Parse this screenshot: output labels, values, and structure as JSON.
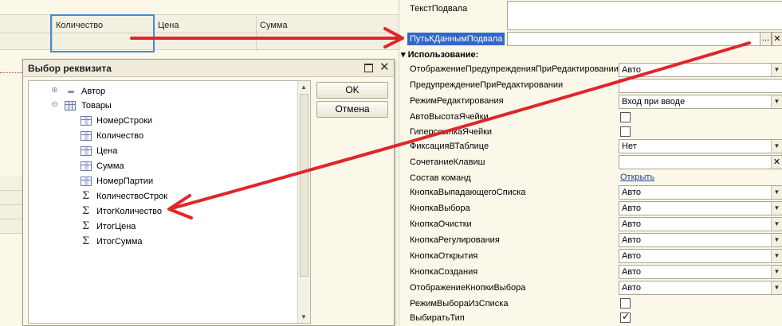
{
  "left_table": {
    "columns": [
      "Количество",
      "Цена",
      "Сумма"
    ]
  },
  "dialog": {
    "title": "Выбор реквизита",
    "ok_label": "OK",
    "cancel_label": "Отмена",
    "tree": {
      "author": "Автор",
      "goods": "Товары",
      "columns": [
        "НомерСтроки",
        "Количество",
        "Цена",
        "Сумма",
        "НомерПартии"
      ],
      "totals": [
        "КоличествоСтрок",
        "ИтогКоличество",
        "ИтогЦена",
        "ИтогСумма"
      ]
    }
  },
  "props": {
    "footer_text_label": "ТекстПодвала",
    "footer_path_label": "ПутьКДаннымПодвала",
    "path_dots": "...",
    "clear_icon": "✕",
    "section_usage": "Использование:",
    "rows": {
      "edit_warning_display": {
        "label": "ОтображениеПредупрежденияПриРедактировании",
        "value": "Авто"
      },
      "edit_warning": {
        "label": "ПредупреждениеПриРедактировании"
      },
      "edit_mode": {
        "label": "РежимРедактирования",
        "value": "Вход при вводе"
      },
      "auto_height": {
        "label": "АвтоВысотаЯчейки"
      },
      "hyperlink": {
        "label": "ГиперссылкаЯчейки"
      },
      "fix_in_table": {
        "label": "ФиксацияВТаблице",
        "value": "Нет"
      },
      "shortcut": {
        "label": "СочетаниеКлавиш"
      },
      "commands": {
        "label": "Состав команд",
        "link": "Открыть"
      },
      "dropdown_button": {
        "label": "КнопкаВыпадающегоСписка",
        "value": "Авто"
      },
      "choice_button": {
        "label": "КнопкаВыбора",
        "value": "Авто"
      },
      "clear_button": {
        "label": "КнопкаОчистки",
        "value": "Авто"
      },
      "adjust_button": {
        "label": "КнопкаРегулирования",
        "value": "Авто"
      },
      "open_button": {
        "label": "КнопкаОткрытия",
        "value": "Авто"
      },
      "create_button": {
        "label": "КнопкаСоздания",
        "value": "Авто"
      },
      "choice_button_display": {
        "label": "ОтображениеКнопкиВыбора",
        "value": "Авто"
      },
      "choice_from_list": {
        "label": "РежимВыбораИзСписка",
        "checked": false
      },
      "choose_type": {
        "label": "ВыбиратьТип",
        "checked": true
      }
    }
  },
  "colors": {
    "arrow": "#e0252b",
    "highlight": "#3c8ed6",
    "selected_label_bg": "#3168c6"
  }
}
